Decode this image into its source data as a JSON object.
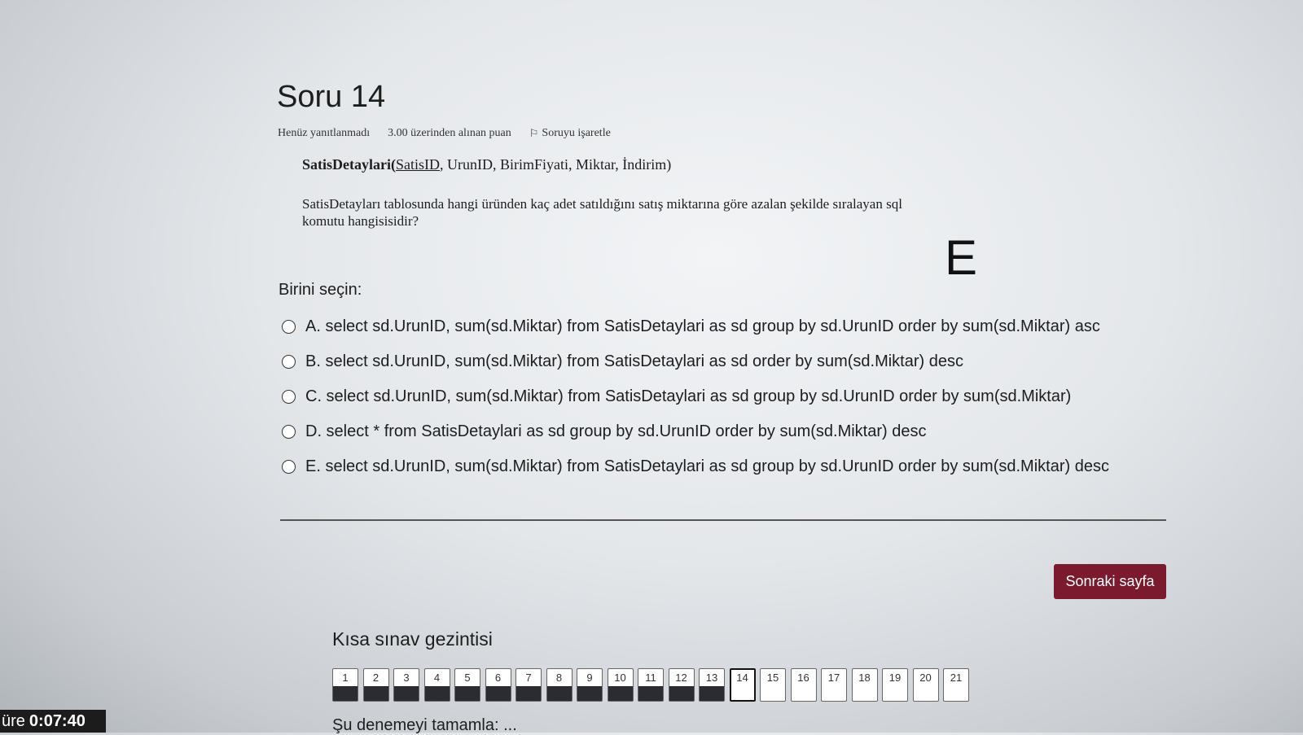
{
  "question": {
    "title": "Soru 14",
    "status": "Henüz yanıtlanmadı",
    "points": "3.00 üzerinden alınan puan",
    "flag_label": "Soruyu işaretle",
    "schema_table": "SatisDetaylari(",
    "schema_pk": "SatisID",
    "schema_rest": ", UrunID, BirimFiyati, Miktar, İndirim)",
    "text": "SatisDetayları tablosunda hangi üründen kaç adet satıldığını satış miktarına göre azalan şekilde sıralayan sql komutu hangisisidir?",
    "handwritten": "E"
  },
  "choices": {
    "prompt": "Birini seçin:",
    "options": [
      {
        "label": "A. select sd.UrunID, sum(sd.Miktar) from SatisDetaylari as sd group by sd.UrunID order by sum(sd.Miktar) asc"
      },
      {
        "label": "B. select sd.UrunID, sum(sd.Miktar) from SatisDetaylari as sd order by sum(sd.Miktar) desc"
      },
      {
        "label": "C. select sd.UrunID, sum(sd.Miktar) from SatisDetaylari as sd group by sd.UrunID order by sum(sd.Miktar)"
      },
      {
        "label": "D. select * from SatisDetaylari as sd group by sd.UrunID order by sum(sd.Miktar) desc"
      },
      {
        "label": "E. select sd.UrunID, sum(sd.Miktar) from SatisDetaylari as sd group by sd.UrunID order by sum(sd.Miktar) desc"
      }
    ]
  },
  "next_button": "Sonraki sayfa",
  "navigation": {
    "title": "Kısa sınav gezintisi",
    "buttons": [
      {
        "label": "1",
        "state": "answered"
      },
      {
        "label": "2",
        "state": "answered"
      },
      {
        "label": "3",
        "state": "answered"
      },
      {
        "label": "4",
        "state": "answered"
      },
      {
        "label": "5",
        "state": "answered"
      },
      {
        "label": "6",
        "state": "answered"
      },
      {
        "label": "7",
        "state": "answered"
      },
      {
        "label": "8",
        "state": "answered"
      },
      {
        "label": "9",
        "state": "answered"
      },
      {
        "label": "10",
        "state": "answered"
      },
      {
        "label": "11",
        "state": "answered"
      },
      {
        "label": "12",
        "state": "answered"
      },
      {
        "label": "13",
        "state": "answered"
      },
      {
        "label": "14",
        "state": "current"
      },
      {
        "label": "15",
        "state": "empty"
      },
      {
        "label": "16",
        "state": "empty"
      },
      {
        "label": "17",
        "state": "empty"
      },
      {
        "label": "18",
        "state": "empty"
      },
      {
        "label": "19",
        "state": "empty"
      },
      {
        "label": "20",
        "state": "empty"
      },
      {
        "label": "21",
        "state": "empty"
      }
    ],
    "finish_link": "Şu denemeyi tamamla: ..."
  },
  "timer": {
    "label": "üre",
    "value": "0:07:40"
  },
  "colors": {
    "accent": "#7b1a2e",
    "answered": "#2a2c31"
  }
}
